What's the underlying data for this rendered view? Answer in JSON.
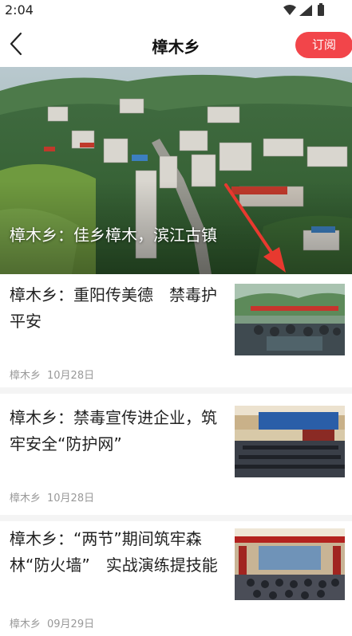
{
  "status_bar": {
    "time": "2:04"
  },
  "header": {
    "title": "樟木乡",
    "subscribe_label": "订阅"
  },
  "banner": {
    "caption": "樟木乡：佳乡樟木，滨江古镇",
    "dot_count": 2,
    "active_dot": 0
  },
  "news": [
    {
      "title": "樟木乡：重阳传美德　禁毒护平安",
      "source": "樟木乡",
      "date": "10月28日",
      "thumb_icon": "meeting-photo"
    },
    {
      "title": "樟木乡：禁毒宣传进企业，筑牢安全“防护网”",
      "source": "樟木乡",
      "date": "10月28日",
      "thumb_icon": "hall-photo"
    },
    {
      "title": "樟木乡：“两节”期间筑牢森林“防火墙”　实战演练提技能",
      "source": "樟木乡",
      "date": "09月29日",
      "thumb_icon": "auditorium-photo"
    }
  ],
  "colors": {
    "accent": "#f2454a",
    "meta_text": "#999999",
    "arrow": "#e8392f"
  }
}
